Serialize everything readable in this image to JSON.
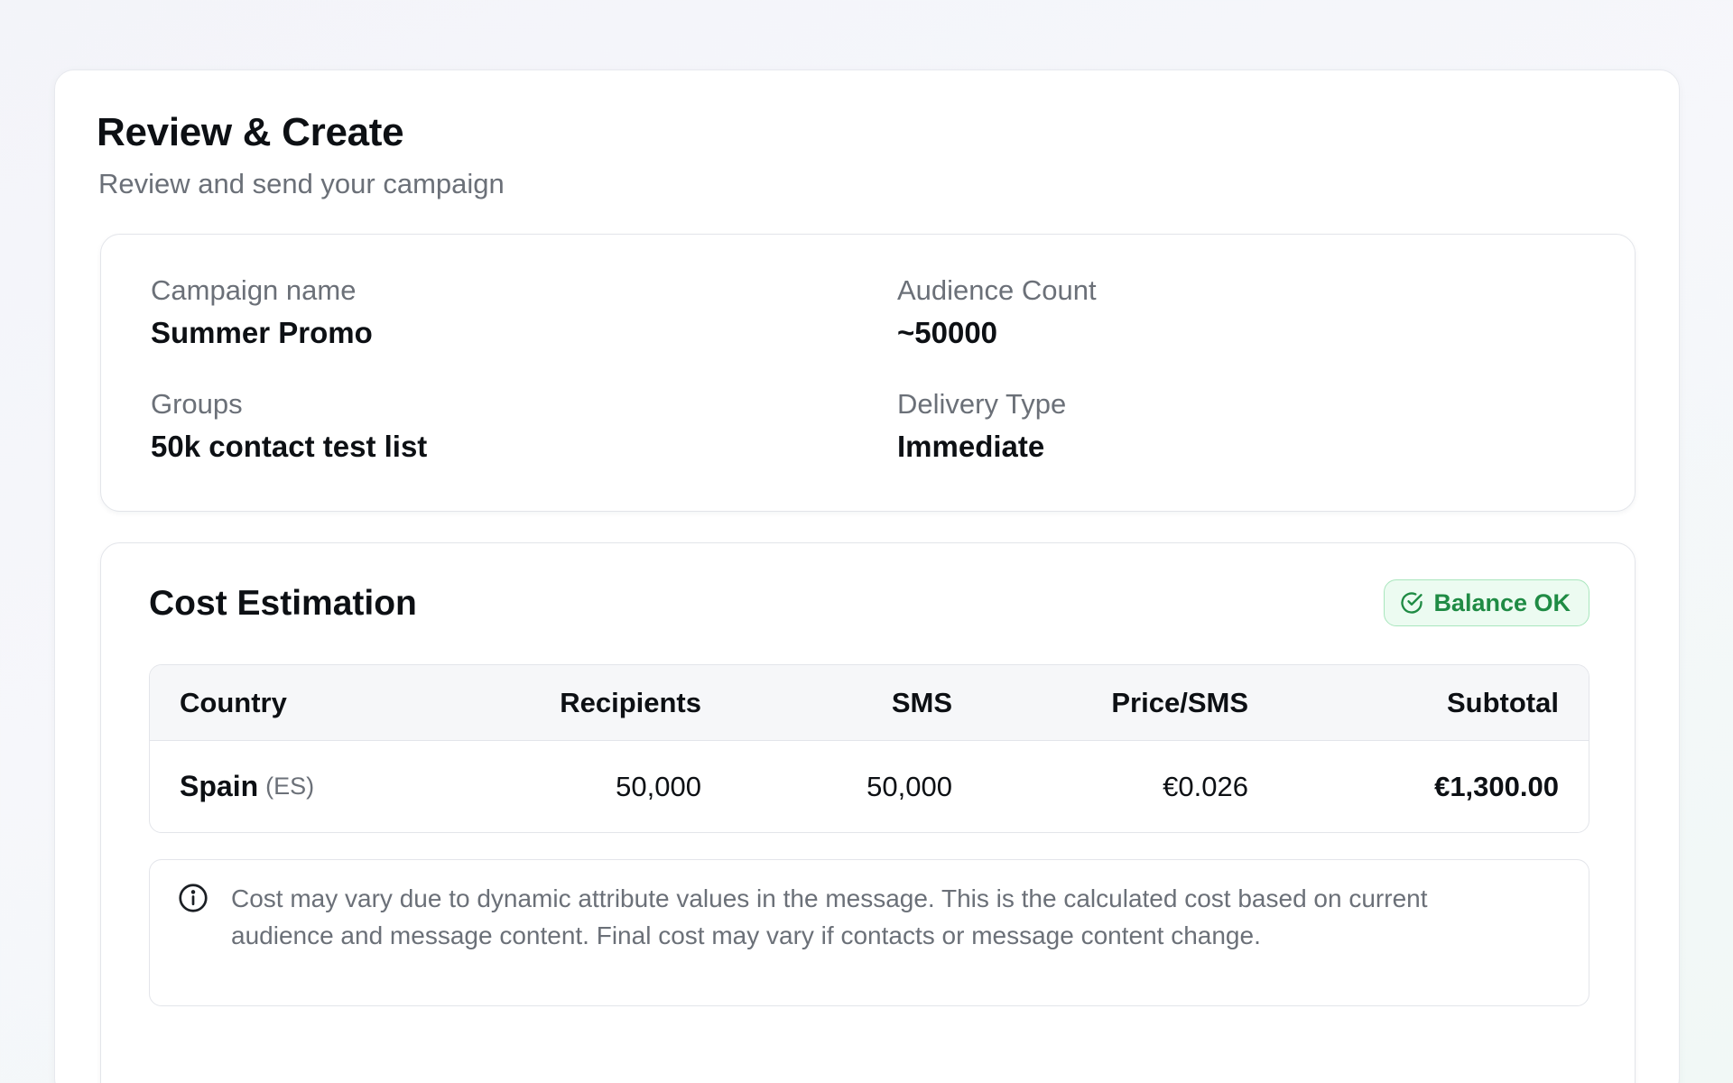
{
  "header": {
    "title": "Review & Create",
    "subtitle": "Review and send your campaign"
  },
  "summary": {
    "campaign_name": {
      "label": "Campaign name",
      "value": "Summer Promo"
    },
    "audience_count": {
      "label": "Audience Count",
      "value": "~50000"
    },
    "groups": {
      "label": "Groups",
      "value": "50k contact test list"
    },
    "delivery_type": {
      "label": "Delivery Type",
      "value": "Immediate"
    }
  },
  "cost": {
    "title": "Cost Estimation",
    "badge": {
      "label": "Balance OK",
      "icon": "check-circle-icon",
      "color": "#1f8b44"
    },
    "columns": [
      "Country",
      "Recipients",
      "SMS",
      "Price/SMS",
      "Subtotal"
    ],
    "rows": [
      {
        "country": "Spain",
        "code": "(ES)",
        "recipients": "50,000",
        "sms": "50,000",
        "price": "€0.026",
        "subtotal": "€1,300.00"
      }
    ],
    "note": {
      "icon": "info-icon",
      "text": "Cost may vary due to dynamic attribute values in the message. This is the calculated cost based on current audience and message content. Final cost may vary if contacts or message content change."
    }
  }
}
